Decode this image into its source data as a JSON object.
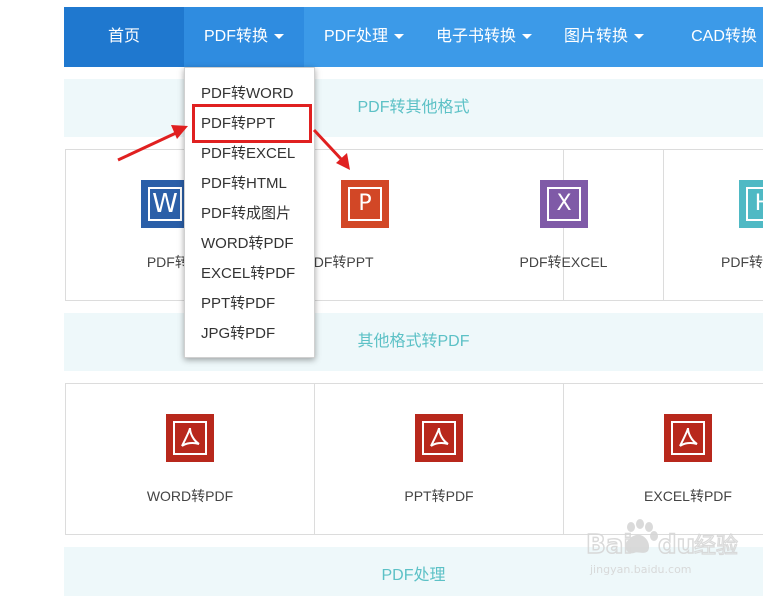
{
  "nav": {
    "items": [
      {
        "label": "首页"
      },
      {
        "label": "PDF转换"
      },
      {
        "label": "PDF处理"
      },
      {
        "label": "电子书转换"
      },
      {
        "label": "图片转换"
      },
      {
        "label": "CAD转换"
      }
    ]
  },
  "dropdown": {
    "items": [
      "PDF转WORD",
      "PDF转PPT",
      "PDF转EXCEL",
      "PDF转HTML",
      "PDF转成图片",
      "WORD转PDF",
      "EXCEL转PDF",
      "PPT转PDF",
      "JPG转PDF"
    ],
    "highlighted_index": 1
  },
  "sections": [
    {
      "title": "PDF转其他格式",
      "cells": [
        {
          "label": "PDF转WORD",
          "icon": "word-icon",
          "letter": "W",
          "color": "#2b5fa8"
        },
        {
          "label": "PDF转PPT",
          "icon": "ppt-icon",
          "letter": "P",
          "color": "#d24726"
        },
        {
          "label": "PDF转EXCEL",
          "icon": "excel-icon",
          "letter": "X",
          "color": "#7f5aa7"
        },
        {
          "label": "PDF转HTML",
          "icon": "html-icon",
          "letter": "H",
          "color": "#4fb9c4"
        }
      ]
    },
    {
      "title": "其他格式转PDF",
      "cells": [
        {
          "label": "WORD转PDF",
          "icon": "pdf-icon",
          "color": "#b8281c"
        },
        {
          "label": "PPT转PDF",
          "icon": "pdf-icon",
          "color": "#b8281c"
        },
        {
          "label": "EXCEL转PDF",
          "icon": "pdf-icon",
          "color": "#b8281c"
        }
      ]
    },
    {
      "title": "PDF处理"
    }
  ],
  "watermark": {
    "brand": "Baidu经验",
    "url": "jingyan.baidu.com"
  },
  "colors": {
    "nav": "#3c9ae8",
    "nav_home": "#1f78cf",
    "section_text": "#5cc1c6",
    "annotation": "#e02020"
  }
}
